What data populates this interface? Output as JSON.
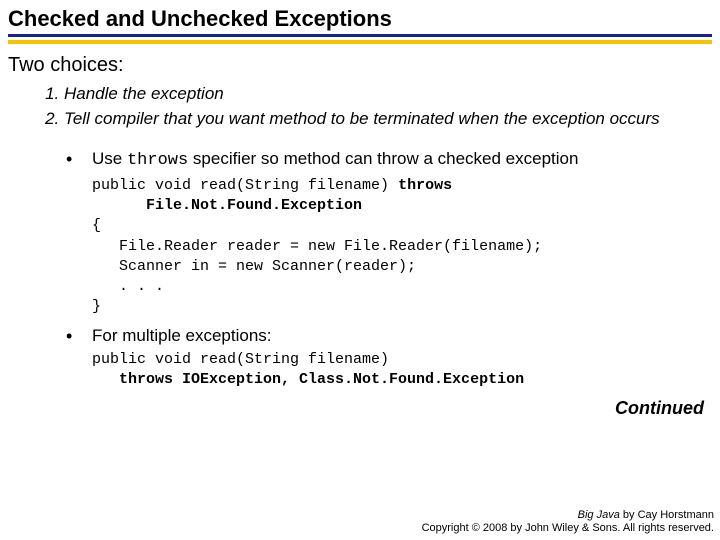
{
  "title": "Checked and Unchecked Exceptions",
  "lead": "Two choices:",
  "numbered": {
    "item1": "Handle the exception",
    "item2": "Tell compiler that you want method to be terminated when the exception occurs"
  },
  "bullets": {
    "b1_pre": "Use ",
    "b1_code": "throws",
    "b1_post": " specifier so method can throw a checked exception",
    "b2": "For multiple exceptions:"
  },
  "code1": {
    "l1a": "public void read(String filename) ",
    "l1b": "throws",
    "l2": "      File.Not.Found.Exception",
    "l3": "{",
    "l4": "   File.Reader reader = new File.Reader(filename);",
    "l5": "   Scanner in = new Scanner(reader);",
    "l6": "   . . .",
    "l7": "}"
  },
  "code2": {
    "l1": "public void read(String filename)",
    "l2a": "   throws ",
    "l2b": "IOException, Class.Not.Found.Exception"
  },
  "continued": "Continued",
  "footer": {
    "book": "Big Java",
    "author": " by Cay Horstmann",
    "copyright": "Copyright © 2008 by John Wiley & Sons. All rights reserved."
  }
}
